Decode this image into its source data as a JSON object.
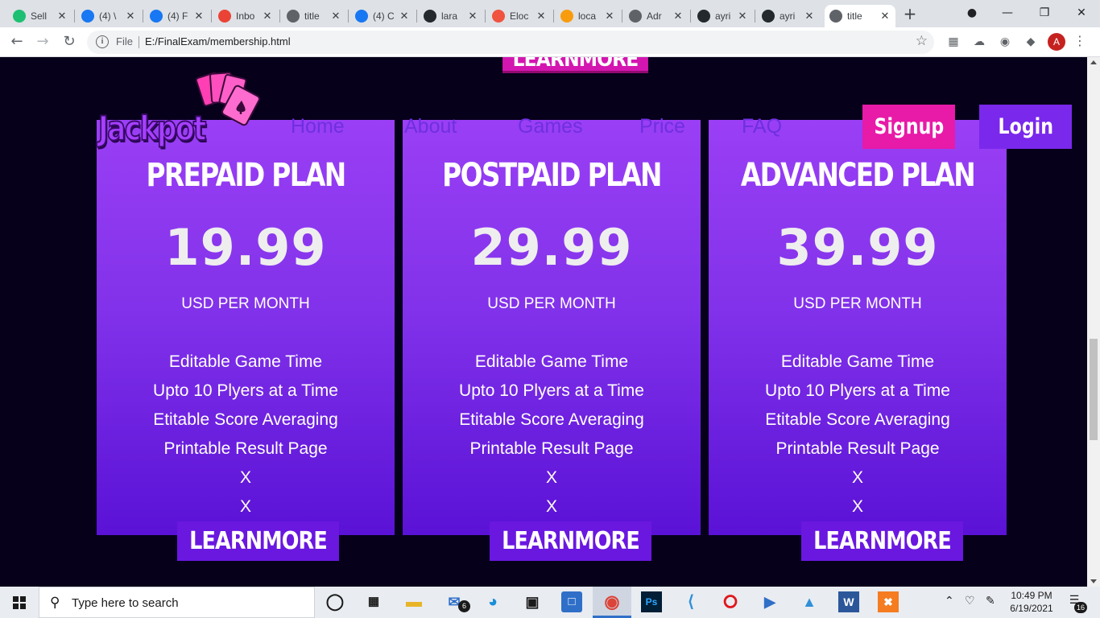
{
  "browser": {
    "tabs": [
      {
        "label": "Sell",
        "icon": "fiverr-icon",
        "color": "#1dbf73"
      },
      {
        "label": "(4) \\",
        "icon": "facebook-icon",
        "color": "#1877f2"
      },
      {
        "label": "(4) F",
        "icon": "facebook-icon",
        "color": "#1877f2"
      },
      {
        "label": "Inbo",
        "icon": "gmail-icon",
        "color": "#ea4335"
      },
      {
        "label": "title",
        "icon": "globe-icon",
        "color": "#5f6368"
      },
      {
        "label": "(4) C",
        "icon": "facebook-icon",
        "color": "#1877f2"
      },
      {
        "label": "lara",
        "icon": "github-icon",
        "color": "#24292e"
      },
      {
        "label": "Eloc",
        "icon": "laravel-icon",
        "color": "#f05340"
      },
      {
        "label": "loca",
        "icon": "phpmyadmin-icon",
        "color": "#f89c0e"
      },
      {
        "label": "Adr",
        "icon": "globe-icon",
        "color": "#5f6368"
      },
      {
        "label": "ayri",
        "icon": "github-icon",
        "color": "#24292e"
      },
      {
        "label": "ayri",
        "icon": "github-icon",
        "color": "#24292e"
      },
      {
        "label": "title",
        "icon": "globe-icon",
        "color": "#5f6368"
      }
    ],
    "active_tab_index": 12,
    "new_tab_label": "+",
    "address": {
      "scheme_label": "File",
      "url": "E:/FinalExam/membership.html"
    },
    "profile_initial": "A"
  },
  "page": {
    "top_partial_button": "LEARNMORE",
    "logo_text": "Jackpot",
    "nav": [
      "Home",
      "About",
      "Games",
      "Price",
      "FAQ"
    ],
    "signup_label": "Signup",
    "login_label": "Login",
    "plans": [
      {
        "name": "PREPAID PLAN",
        "price": "19.99",
        "period": "USD PER MONTH",
        "features": [
          "Editable Game Time",
          "Upto 10 Plyers at a Time",
          "Etitable Score Averaging",
          "Printable Result Page",
          "X",
          "X"
        ],
        "button": "LEARNMORE"
      },
      {
        "name": "POSTPAID PLAN",
        "price": "29.99",
        "period": "USD PER MONTH",
        "features": [
          "Editable Game Time",
          "Upto 10 Plyers at a Time",
          "Etitable Score Averaging",
          "Printable Result Page",
          "X",
          "X"
        ],
        "button": "LEARNMORE"
      },
      {
        "name": "ADVANCED PLAN",
        "price": "39.99",
        "period": "USD PER MONTH",
        "features": [
          "Editable Game Time",
          "Upto 10 Plyers at a Time",
          "Etitable Score Averaging",
          "Printable Result Page",
          "X",
          "X"
        ],
        "button": "LEARNMORE"
      }
    ],
    "colors": {
      "background": "#06001a",
      "card_top": "#9a3ff5",
      "card_bottom": "#5a12d6",
      "signup": "#e81aa8",
      "login": "#7a28ec"
    }
  },
  "taskbar": {
    "search_placeholder": "Type here to search",
    "mail_badge": "6",
    "time": "10:49 PM",
    "date": "6/19/2021",
    "notification_count": "16"
  }
}
